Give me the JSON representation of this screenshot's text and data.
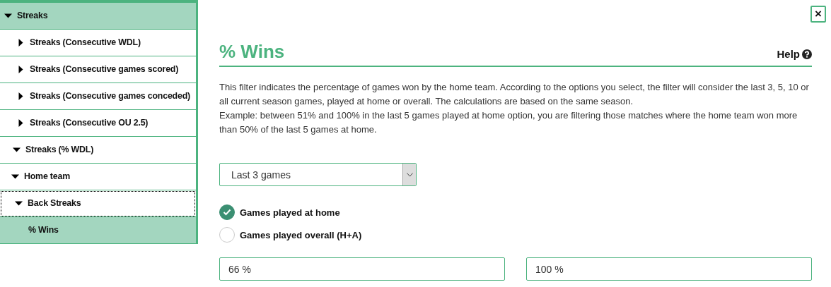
{
  "sidebar": {
    "tree": [
      {
        "label": "Streaks",
        "kind": "section",
        "expanded": true,
        "focused": false,
        "children": [
          {
            "label": "Streaks (Consecutive WDL)",
            "expanded": false,
            "selected": false,
            "focused": false
          },
          {
            "label": "Streaks (Consecutive games scored)",
            "expanded": false,
            "selected": false,
            "focused": false
          },
          {
            "label": "Streaks (Consecutive games conceded)",
            "expanded": false,
            "selected": false,
            "focused": false
          },
          {
            "label": "Streaks (Consecutive OU 2.5)",
            "expanded": false,
            "selected": false,
            "focused": false
          },
          {
            "label": "Streaks (% WDL)",
            "expanded": true,
            "selected": false,
            "focused": false,
            "children": [
              {
                "label": "Home team",
                "expanded": true,
                "selected": false,
                "focused": false,
                "children": [
                  {
                    "label": "Back Streaks",
                    "expanded": true,
                    "selected": false,
                    "focused": true,
                    "children": [
                      {
                        "label": "% Wins",
                        "selected": true,
                        "focused": false
                      }
                    ]
                  }
                ]
              }
            ]
          }
        ]
      }
    ]
  },
  "panel": {
    "close_label": "×",
    "title": "% Wins",
    "help_label": "Help",
    "description": [
      "This filter indicates the percentage of games won by the home team. According to the options you select, the filter will consider the last 3, 5, 10 or all current season games, played at home or overall. The calculations are based on the same season.",
      "Example: between 51% and 100% in the last 5 games played at home option, you are filtering those matches where the home team won more than 50% of the last 5 games at home."
    ],
    "period_select": {
      "value": "Last 3 games"
    },
    "options": [
      {
        "label": "Games played at home",
        "selected": true
      },
      {
        "label": "Games played overall (H+A)",
        "selected": false
      }
    ],
    "range": [
      {
        "value": "66 %"
      },
      {
        "value": "100 %"
      }
    ]
  }
}
